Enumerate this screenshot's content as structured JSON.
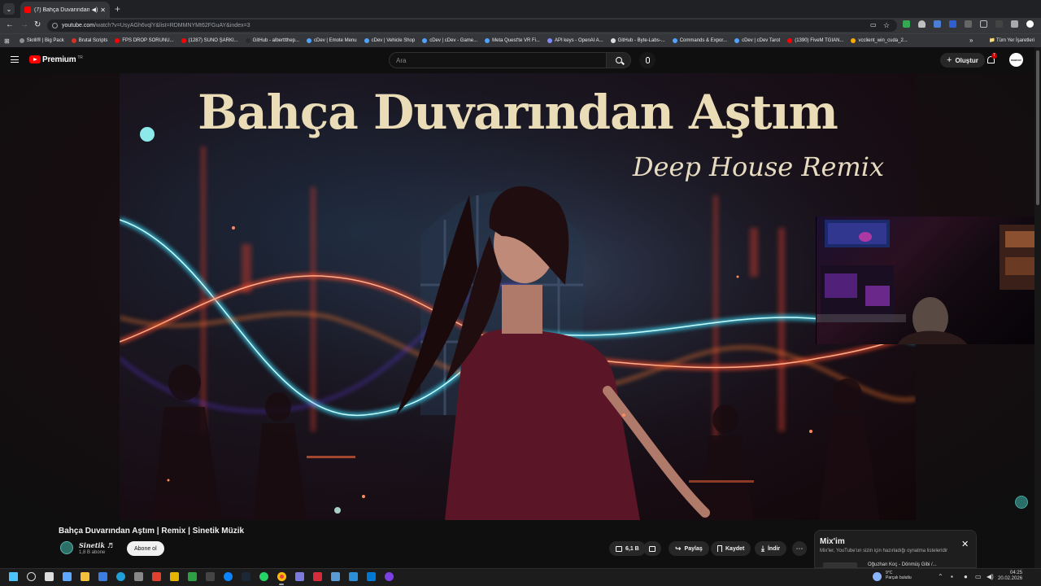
{
  "browser": {
    "tab_title": "(7) Bahça Duvarından Aştım",
    "address_host": "youtube.com",
    "address_path": "/watch?v=UsyAGh6vqlY&list=RDMMNYMt62FGuAY&index=3",
    "bookmarks": [
      {
        "label": "Skrill® | Big Pack",
        "color": "#8e8e8e"
      },
      {
        "label": "Brutal Scripts",
        "color": "#d93025"
      },
      {
        "label": "FPS DROP SORUNU...",
        "color": "#ff0000"
      },
      {
        "label": "(1287) SUNO ŞARKI...",
        "color": "#ff0000"
      },
      {
        "label": "GitHub - alberttthep...",
        "color": "#2a2a2a"
      },
      {
        "label": "cDev | Emote Menu",
        "color": "#4fa3ff"
      },
      {
        "label": "cDev | Vehicle Shop",
        "color": "#4fa3ff"
      },
      {
        "label": "cDev | cDev - Game...",
        "color": "#4fa3ff"
      },
      {
        "label": "Meta Quest'te VR Fi...",
        "color": "#4fa3ff"
      },
      {
        "label": "API keys - OpenAI A...",
        "color": "#7f8cff"
      },
      {
        "label": "GitHub - Byte-Labs-...",
        "color": "#dddddd"
      },
      {
        "label": "Commands & Expor...",
        "color": "#4fa3ff"
      },
      {
        "label": "cDev | cDev Tarot",
        "color": "#4fa3ff"
      },
      {
        "label": "(1390) FiveM TGIAN...",
        "color": "#ff0000"
      },
      {
        "label": "vcclient_win_cuda_2...",
        "color": "#f9ab00"
      }
    ],
    "all_bookmarks": "Tüm Yer İşaretleri"
  },
  "youtube": {
    "logo_label": "Premium",
    "logo_region": "TR",
    "search_placeholder": "Ara",
    "create_label": "Oluştur",
    "notification_count": "7",
    "avatar_text": "DEBDOV"
  },
  "video": {
    "overlay_title": "Bahça Duvarından Aştım",
    "overlay_subtitle": "Deep House Remix",
    "title": "Bahça Duvarından Aştım | Remix | Sinetik Müzik",
    "channel_name": "Sinetik ♬",
    "channel_subs": "1,8 B abone",
    "subscribe_label": "Abone ol",
    "like_count": "6,1 B",
    "share_label": "Paylaş",
    "save_label": "Kaydet",
    "download_label": "İndir"
  },
  "mix": {
    "title": "Mix'im",
    "description": "Mix'ler, YouTube'un sizin için hazırladığı oynatma listeleridir",
    "next_item": "Oğuzhan Koç - Dönmüş Gibi /..."
  },
  "taskbar": {
    "weather_temp": "9°C",
    "weather_desc": "Parçalı bulutlu",
    "time": "04:25",
    "date": "20.02.2026"
  },
  "colors": {
    "youtube_red": "#ff0000",
    "background": "#0f0f0f",
    "title_gold": "#e9dcb7"
  }
}
